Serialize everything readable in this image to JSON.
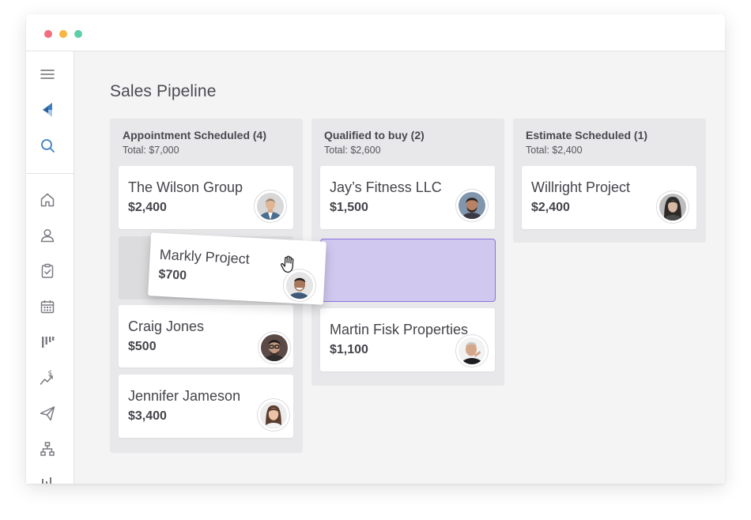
{
  "window": {
    "controls": [
      "close",
      "minimize",
      "maximize"
    ],
    "control_colors": [
      "#f26d7d",
      "#f5b642",
      "#5ccfa9"
    ]
  },
  "sidebar": {
    "items": [
      {
        "icon": "menu-icon"
      },
      {
        "icon": "logo-icon"
      },
      {
        "icon": "search-icon"
      },
      {
        "icon": "home-icon"
      },
      {
        "icon": "contacts-icon"
      },
      {
        "icon": "tasks-icon"
      },
      {
        "icon": "calendar-icon"
      },
      {
        "icon": "pipeline-icon"
      },
      {
        "icon": "sales-icon"
      },
      {
        "icon": "campaigns-icon"
      },
      {
        "icon": "org-chart-icon"
      },
      {
        "icon": "reports-icon"
      }
    ]
  },
  "page": {
    "title": "Sales Pipeline"
  },
  "columns": [
    {
      "title": "Appointment Scheduled (4)",
      "total": "Total: $7,000",
      "cards": [
        {
          "name": "The Wilson Group",
          "amount": "$2,400"
        },
        {
          "name": "Craig Jones",
          "amount": "$500"
        },
        {
          "name": "Jennifer Jameson",
          "amount": "$3,400"
        }
      ]
    },
    {
      "title": "Qualified to buy (2)",
      "total": "Total: $2,600",
      "cards": [
        {
          "name": "Jay’s Fitness LLC",
          "amount": "$1,500"
        },
        {
          "name": "Martin Fisk Properties",
          "amount": "$1,100"
        }
      ]
    },
    {
      "title": "Estimate Scheduled (1)",
      "total": "Total: $2,400",
      "cards": [
        {
          "name": "Willright Project",
          "amount": "$2,400"
        }
      ]
    }
  ],
  "dragging_card": {
    "name": "Markly Project",
    "amount": "$700"
  },
  "colors": {
    "accent_purple": "#8b73de",
    "drop_fill": "#d0c8ee",
    "logo_blue": "#3f7fc1"
  }
}
